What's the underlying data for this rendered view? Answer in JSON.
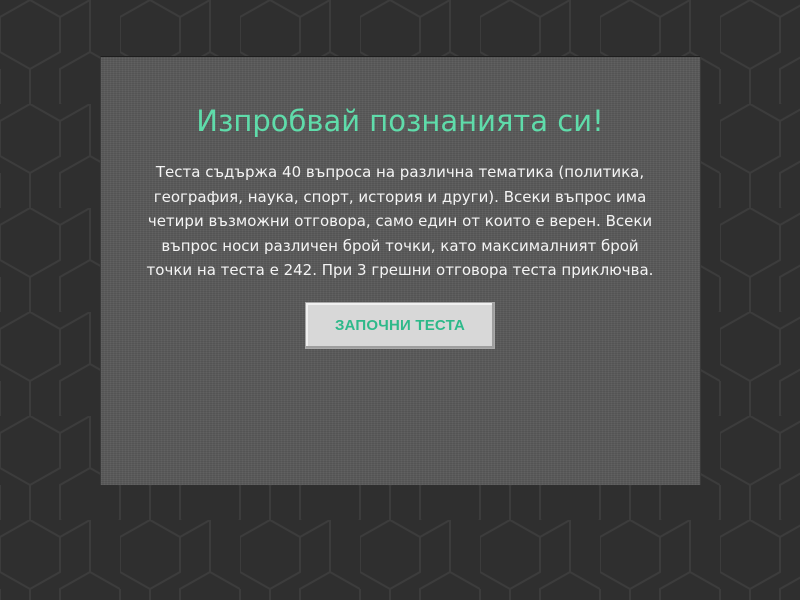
{
  "quiz": {
    "title": "Изпробвай познанията си!",
    "description": "Теста съдържа 40 въпроса на различна тематика (политика, география, наука, спорт, история и други). Всеки въпрос има четири възможни отговора, само един от които е верен. Всеки въпрос носи различен брой точки, като максималният брой точки на теста е 242. При 3 грешни отговора теста приключва.",
    "start_button_label": "ЗАПОЧНИ ТЕСТА"
  },
  "colors": {
    "background": "#2f2f2f",
    "panel": "#5a5a5a",
    "accent": "#5fdcaa",
    "button_text": "#2eb98a",
    "button_bg": "#d8d8d8"
  }
}
